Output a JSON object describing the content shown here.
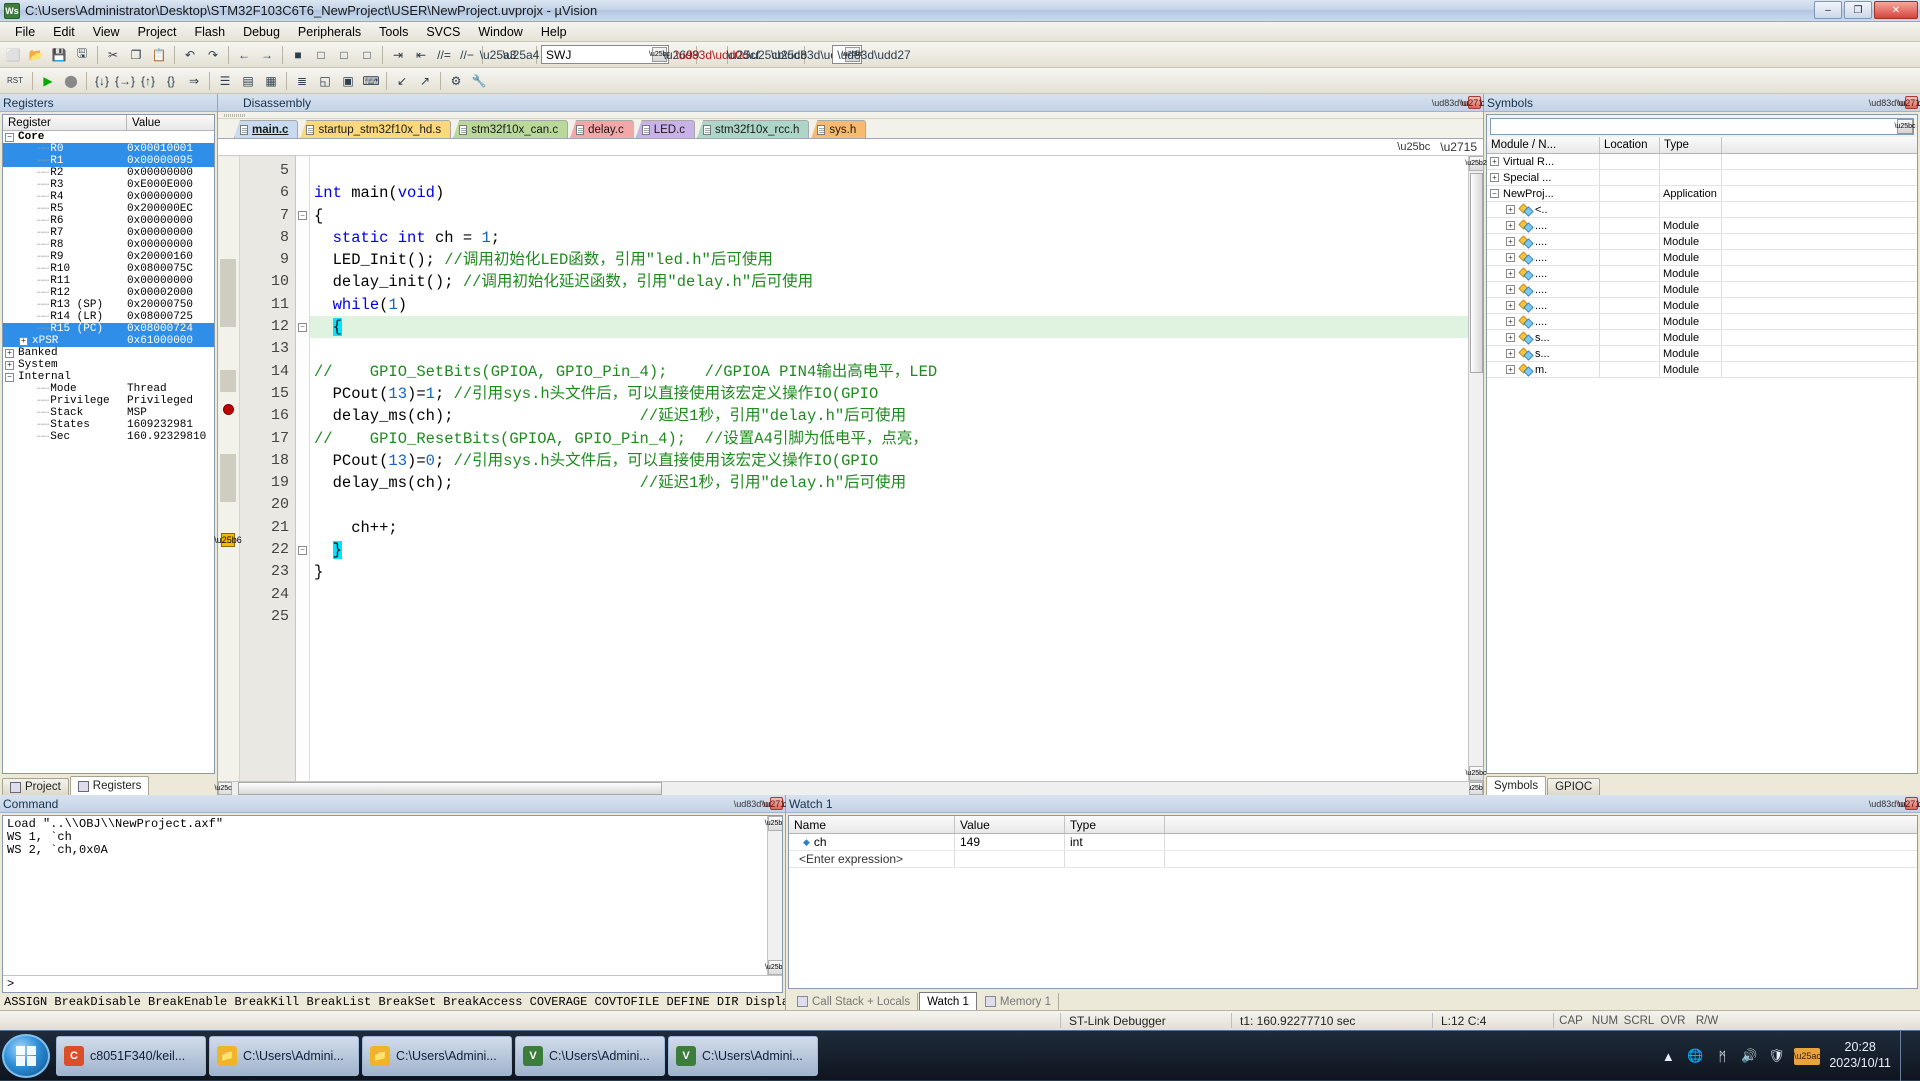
{
  "window": {
    "title": "C:\\Users\\Administrator\\Desktop\\STM32F103C6T6_NewProject\\USER\\NewProject.uvprojx - µVision",
    "app_icon": "uvision-icon",
    "minimize": "–",
    "maximize": "❐",
    "close": "✕"
  },
  "menu": {
    "items": [
      "File",
      "Edit",
      "View",
      "Project",
      "Flash",
      "Debug",
      "Peripherals",
      "Tools",
      "SVCS",
      "Window",
      "Help"
    ]
  },
  "toolbar1": {
    "buttons": [
      {
        "name": "new-file-icon",
        "glyph": "⬜"
      },
      {
        "name": "open-file-icon",
        "glyph": "📂"
      },
      {
        "name": "save-icon",
        "glyph": "💾"
      },
      {
        "name": "save-all-icon",
        "glyph": "🖫"
      },
      {
        "name": "cut-icon",
        "glyph": "✂"
      },
      {
        "name": "copy-icon",
        "glyph": "❐"
      },
      {
        "name": "paste-icon",
        "glyph": "📋"
      },
      {
        "name": "undo-icon",
        "glyph": "↶"
      },
      {
        "name": "redo-icon",
        "glyph": "↷"
      },
      {
        "name": "navigate-back-icon",
        "glyph": "←"
      },
      {
        "name": "navigate-forward-icon",
        "glyph": "→"
      },
      {
        "name": "bookmark-toggle-icon",
        "glyph": "■"
      },
      {
        "name": "bookmark-prev-icon",
        "glyph": "□"
      },
      {
        "name": "bookmark-next-icon",
        "glyph": "□"
      },
      {
        "name": "bookmark-clear-icon",
        "glyph": "□"
      },
      {
        "name": "indent-icon",
        "glyph": "⇥"
      },
      {
        "name": "outdent-icon",
        "glyph": "⇤"
      },
      {
        "name": "comment-icon",
        "glyph": "//="
      },
      {
        "name": "uncomment-icon",
        "glyph": "//−"
      }
    ],
    "debug_select_value": "SWJ",
    "search_placeholder": ""
  },
  "toolbar2": {
    "buttons": [
      {
        "name": "reset-cpu-icon",
        "glyph": "RST"
      },
      {
        "name": "run-icon",
        "glyph": "▶"
      },
      {
        "name": "stop-icon",
        "glyph": "⬤"
      },
      {
        "name": "step-icon",
        "glyph": "{↓}"
      },
      {
        "name": "step-over-icon",
        "glyph": "{→}"
      },
      {
        "name": "step-out-icon",
        "glyph": "{↑}"
      },
      {
        "name": "run-to-cursor-icon",
        "glyph": "{}"
      },
      {
        "name": "show-next-statement-icon",
        "glyph": "⇒"
      },
      {
        "name": "disassembly-window-icon",
        "glyph": "☰"
      },
      {
        "name": "symbols-window-icon",
        "glyph": "▤"
      },
      {
        "name": "registers-window-icon",
        "glyph": "▦"
      },
      {
        "name": "call-stack-icon",
        "glyph": "≣"
      },
      {
        "name": "watch-windows-icon",
        "glyph": "◱"
      },
      {
        "name": "memory-windows-icon",
        "glyph": "▣"
      },
      {
        "name": "serial-windows-icon",
        "glyph": "⌨"
      },
      {
        "name": "analysis-windows-icon",
        "glyph": "↙"
      },
      {
        "name": "trace-icon",
        "glyph": "↗"
      },
      {
        "name": "system-viewer-icon",
        "glyph": "⚙"
      },
      {
        "name": "toolbox-icon",
        "glyph": "🔧"
      }
    ]
  },
  "registers_panel": {
    "title": "Registers",
    "columns": [
      "Register",
      "Value"
    ],
    "rows": [
      {
        "name": "Core",
        "value": "",
        "indent": 0,
        "expander": "−",
        "selected": false,
        "bold": true
      },
      {
        "name": "R0",
        "value": "0x00010001",
        "indent": 2,
        "expander": "",
        "selected": true
      },
      {
        "name": "R1",
        "value": "0x00000095",
        "indent": 2,
        "expander": "",
        "selected": true
      },
      {
        "name": "R2",
        "value": "0x00000000",
        "indent": 2,
        "expander": "",
        "selected": false
      },
      {
        "name": "R3",
        "value": "0xE000E000",
        "indent": 2,
        "expander": "",
        "selected": false
      },
      {
        "name": "R4",
        "value": "0x00000000",
        "indent": 2,
        "expander": "",
        "selected": false
      },
      {
        "name": "R5",
        "value": "0x200000EC",
        "indent": 2,
        "expander": "",
        "selected": false
      },
      {
        "name": "R6",
        "value": "0x00000000",
        "indent": 2,
        "expander": "",
        "selected": false
      },
      {
        "name": "R7",
        "value": "0x00000000",
        "indent": 2,
        "expander": "",
        "selected": false
      },
      {
        "name": "R8",
        "value": "0x00000000",
        "indent": 2,
        "expander": "",
        "selected": false
      },
      {
        "name": "R9",
        "value": "0x20000160",
        "indent": 2,
        "expander": "",
        "selected": false
      },
      {
        "name": "R10",
        "value": "0x0800075C",
        "indent": 2,
        "expander": "",
        "selected": false
      },
      {
        "name": "R11",
        "value": "0x00000000",
        "indent": 2,
        "expander": "",
        "selected": false
      },
      {
        "name": "R12",
        "value": "0x00002000",
        "indent": 2,
        "expander": "",
        "selected": false
      },
      {
        "name": "R13 (SP)",
        "value": "0x20000750",
        "indent": 2,
        "expander": "",
        "selected": false
      },
      {
        "name": "R14 (LR)",
        "value": "0x08000725",
        "indent": 2,
        "expander": "",
        "selected": false
      },
      {
        "name": "R15 (PC)",
        "value": "0x08000724",
        "indent": 2,
        "expander": "",
        "selected": true
      },
      {
        "name": "xPSR",
        "value": "0x61000000",
        "indent": 1,
        "expander": "+",
        "selected": true
      },
      {
        "name": "Banked",
        "value": "",
        "indent": 0,
        "expander": "+",
        "selected": false
      },
      {
        "name": "System",
        "value": "",
        "indent": 0,
        "expander": "+",
        "selected": false
      },
      {
        "name": "Internal",
        "value": "",
        "indent": 0,
        "expander": "−",
        "selected": false
      },
      {
        "name": "Mode",
        "value": "Thread",
        "indent": 2,
        "expander": "",
        "selected": false
      },
      {
        "name": "Privilege",
        "value": "Privileged",
        "indent": 2,
        "expander": "",
        "selected": false
      },
      {
        "name": "Stack",
        "value": "MSP",
        "indent": 2,
        "expander": "",
        "selected": false
      },
      {
        "name": "States",
        "value": "1609232981",
        "indent": 2,
        "expander": "",
        "selected": false
      },
      {
        "name": "Sec",
        "value": "160.92329810",
        "indent": 2,
        "expander": "",
        "selected": false
      }
    ],
    "bottom_tabs": [
      {
        "label": "Project",
        "icon": "project-icon",
        "active": false
      },
      {
        "label": "Registers",
        "icon": "registers-icon",
        "active": true
      }
    ]
  },
  "editor": {
    "disassembly_title": "Disassembly",
    "tabs": [
      {
        "label": "main.c",
        "color": "#c9d9f0",
        "active": true
      },
      {
        "label": "startup_stm32f10x_hd.s",
        "color": "#fbd97a",
        "active": false
      },
      {
        "label": "stm32f10x_can.c",
        "color": "#b9d89a",
        "active": false
      },
      {
        "label": "delay.c",
        "color": "#f2a8a8",
        "active": false
      },
      {
        "label": "LED.c",
        "color": "#c9b2e8",
        "active": false
      },
      {
        "label": "stm32f10x_rcc.h",
        "color": "#aed6c8",
        "active": false
      },
      {
        "label": "sys.h",
        "color": "#f6bb6e",
        "active": false
      }
    ],
    "tab_menu_icon": "chevron-down-icon",
    "tab_close_icon": "close-icon",
    "lines": [
      {
        "num": 5,
        "fold": "",
        "segments": [],
        "highlight": false
      },
      {
        "num": 6,
        "fold": "",
        "segments": [
          {
            "t": "int",
            "c": "kw"
          },
          {
            "t": " main",
            "c": "plain"
          },
          {
            "t": "(",
            "c": "plain"
          },
          {
            "t": "void",
            "c": "kw"
          },
          {
            "t": ")",
            "c": "plain"
          }
        ],
        "highlight": false
      },
      {
        "num": 7,
        "fold": "−",
        "segments": [
          {
            "t": "{",
            "c": "plain"
          }
        ],
        "highlight": false
      },
      {
        "num": 8,
        "fold": "",
        "segments": [
          {
            "t": "  ",
            "c": "plain"
          },
          {
            "t": "static",
            "c": "kw"
          },
          {
            "t": " ",
            "c": "plain"
          },
          {
            "t": "int",
            "c": "kw"
          },
          {
            "t": " ch = ",
            "c": "plain"
          },
          {
            "t": "1",
            "c": "num"
          },
          {
            "t": ";",
            "c": "plain"
          }
        ],
        "highlight": false
      },
      {
        "num": 9,
        "fold": "",
        "segments": [
          {
            "t": "  LED_Init(); ",
            "c": "plain"
          },
          {
            "t": "//调用初始化LED函数，引用\"led.h\"后可使用",
            "c": "cmt"
          }
        ],
        "highlight": false
      },
      {
        "num": 10,
        "fold": "",
        "segments": [
          {
            "t": "  delay_init(); ",
            "c": "plain"
          },
          {
            "t": "//调用初始化延迟函数，引用\"delay.h\"后可使用",
            "c": "cmt"
          }
        ],
        "highlight": false
      },
      {
        "num": 11,
        "fold": "",
        "segments": [
          {
            "t": "  ",
            "c": "plain"
          },
          {
            "t": "while",
            "c": "kw"
          },
          {
            "t": "(",
            "c": "plain"
          },
          {
            "t": "1",
            "c": "num"
          },
          {
            "t": ")",
            "c": "plain"
          }
        ],
        "highlight": false
      },
      {
        "num": 12,
        "fold": "−",
        "segments": [
          {
            "t": "  ",
            "c": "plain"
          },
          {
            "t": "{",
            "c": "cursor"
          }
        ],
        "highlight": true
      },
      {
        "num": 13,
        "fold": "",
        "segments": [],
        "highlight": false
      },
      {
        "num": 14,
        "fold": "",
        "segments": [
          {
            "t": "//    GPIO_SetBits(GPIOA, GPIO_Pin_4);    //GPIOA PIN4输出高电平，LED",
            "c": "cmt"
          }
        ],
        "highlight": false
      },
      {
        "num": 15,
        "fold": "",
        "segments": [
          {
            "t": "  PCout(",
            "c": "plain"
          },
          {
            "t": "13",
            "c": "num"
          },
          {
            "t": ")=",
            "c": "plain"
          },
          {
            "t": "1",
            "c": "num"
          },
          {
            "t": "; ",
            "c": "plain"
          },
          {
            "t": "//引用sys.h头文件后，可以直接使用该宏定义操作IO(GPIO",
            "c": "cmt"
          }
        ],
        "highlight": false
      },
      {
        "num": 16,
        "fold": "",
        "segments": [
          {
            "t": "  delay_ms(ch);                    ",
            "c": "plain"
          },
          {
            "t": "//延迟1秒，引用\"delay.h\"后可使用",
            "c": "cmt"
          }
        ],
        "highlight": false
      },
      {
        "num": 17,
        "fold": "",
        "segments": [
          {
            "t": "//    GPIO_ResetBits(GPIOA, GPIO_Pin_4);  //设置A4引脚为低电平，点亮，",
            "c": "cmt"
          }
        ],
        "highlight": false
      },
      {
        "num": 18,
        "fold": "",
        "segments": [
          {
            "t": "  PCout(",
            "c": "plain"
          },
          {
            "t": "13",
            "c": "num"
          },
          {
            "t": ")=",
            "c": "plain"
          },
          {
            "t": "0",
            "c": "num"
          },
          {
            "t": "; ",
            "c": "plain"
          },
          {
            "t": "//引用sys.h头文件后，可以直接使用该宏定义操作IO(GPIO",
            "c": "cmt"
          }
        ],
        "highlight": false
      },
      {
        "num": 19,
        "fold": "",
        "segments": [
          {
            "t": "  delay_ms(ch);                    ",
            "c": "plain"
          },
          {
            "t": "//延迟1秒，引用\"delay.h\"后可使用",
            "c": "cmt"
          }
        ],
        "highlight": false
      },
      {
        "num": 20,
        "fold": "",
        "segments": [],
        "highlight": false
      },
      {
        "num": 21,
        "fold": "",
        "segments": [
          {
            "t": "    ch++;",
            "c": "plain"
          }
        ],
        "highlight": false
      },
      {
        "num": 22,
        "fold": "−",
        "segments": [
          {
            "t": "  ",
            "c": "plain"
          },
          {
            "t": "}",
            "c": "cursor"
          }
        ],
        "highlight": false
      },
      {
        "num": 23,
        "fold": "",
        "segments": [
          {
            "t": "}",
            "c": "plain"
          }
        ],
        "highlight": false
      },
      {
        "num": 24,
        "fold": "",
        "segments": [],
        "highlight": false
      },
      {
        "num": 25,
        "fold": "",
        "segments": [],
        "highlight": false
      }
    ],
    "breakpoint_marker": "breakpoint-icon",
    "execution_marker": "execution-arrow-icon"
  },
  "symbols_panel": {
    "title": "Symbols",
    "filter_value": "",
    "columns": [
      "Module / N...",
      "Location",
      "Type"
    ],
    "rows": [
      {
        "name": "Virtual R...",
        "location": "",
        "type": "",
        "indent": 0,
        "expander": "+",
        "icon": false
      },
      {
        "name": "Special ...",
        "location": "",
        "type": "",
        "indent": 0,
        "expander": "+",
        "icon": false
      },
      {
        "name": "NewProj...",
        "location": "",
        "type": "Application",
        "indent": 0,
        "expander": "−",
        "icon": false
      },
      {
        "name": "<..",
        "location": "",
        "type": "",
        "indent": 1,
        "expander": "+",
        "icon": true
      },
      {
        "name": "....",
        "location": "",
        "type": "Module",
        "indent": 1,
        "expander": "+",
        "icon": true
      },
      {
        "name": "....",
        "location": "",
        "type": "Module",
        "indent": 1,
        "expander": "+",
        "icon": true
      },
      {
        "name": "....",
        "location": "",
        "type": "Module",
        "indent": 1,
        "expander": "+",
        "icon": true
      },
      {
        "name": "....",
        "location": "",
        "type": "Module",
        "indent": 1,
        "expander": "+",
        "icon": true
      },
      {
        "name": "....",
        "location": "",
        "type": "Module",
        "indent": 1,
        "expander": "+",
        "icon": true
      },
      {
        "name": "....",
        "location": "",
        "type": "Module",
        "indent": 1,
        "expander": "+",
        "icon": true
      },
      {
        "name": "....",
        "location": "",
        "type": "Module",
        "indent": 1,
        "expander": "+",
        "icon": true
      },
      {
        "name": "s...",
        "location": "",
        "type": "Module",
        "indent": 1,
        "expander": "+",
        "icon": true
      },
      {
        "name": "s...",
        "location": "",
        "type": "Module",
        "indent": 1,
        "expander": "+",
        "icon": true
      },
      {
        "name": "m.",
        "location": "",
        "type": "Module",
        "indent": 1,
        "expander": "+",
        "icon": true
      }
    ],
    "bottom_tabs": [
      {
        "label": "Symbols",
        "active": true
      },
      {
        "label": "GPIOC",
        "active": false
      }
    ]
  },
  "command_panel": {
    "title": "Command",
    "output_lines": [
      "Load \"..\\\\OBJ\\\\NewProject.axf\"",
      "WS 1, `ch",
      "WS 2, `ch,0x0A"
    ],
    "prompt": ">",
    "help_line": "ASSIGN BreakDisable BreakEnable BreakKill BreakList BreakSet BreakAccess COVERAGE COVTOFILE DEFINE DIR Display Enter"
  },
  "watch_panel": {
    "title": "Watch 1",
    "columns": [
      "Name",
      "Value",
      "Type"
    ],
    "rows": [
      {
        "name": "ch",
        "value": "149",
        "type": "int",
        "has_icon": true
      },
      {
        "name": "<Enter expression>",
        "value": "",
        "type": "",
        "has_icon": false
      }
    ],
    "bottom_tabs": [
      {
        "label": "Call Stack + Locals",
        "icon": "call-stack-icon",
        "active": false
      },
      {
        "label": "Watch 1",
        "icon": "",
        "active": true
      },
      {
        "label": "Memory 1",
        "icon": "memory-icon",
        "active": false
      }
    ]
  },
  "statusbar": {
    "debugger": "ST-Link Debugger",
    "time": "t1: 160.92277710 sec",
    "position": "L:12 C:4",
    "flags": [
      "CAP",
      "NUM",
      "SCRL",
      "OVR",
      "R/W"
    ]
  },
  "taskbar": {
    "start_icon": "windows-start-icon",
    "items": [
      {
        "label": "c8051F340/keil...",
        "icon_color": "#d94f2a",
        "icon_text": "C"
      },
      {
        "label": "C:\\Users\\Admini...",
        "icon_color": "#f0b429",
        "icon_text": "📁"
      },
      {
        "label": "C:\\Users\\Admini...",
        "icon_color": "#f0b429",
        "icon_text": "📁"
      },
      {
        "label": "C:\\Users\\Admini...",
        "icon_color": "#3c7d3c",
        "icon_text": "V"
      },
      {
        "label": "C:\\Users\\Admini...",
        "icon_color": "#3c7d3c",
        "icon_text": "V"
      }
    ],
    "tray": [
      {
        "name": "show-hidden-icon",
        "glyph": "▲"
      },
      {
        "name": "network-icon",
        "glyph": "🌐"
      },
      {
        "name": "bluetooth-icon",
        "glyph": "ᛗ"
      },
      {
        "name": "volume-icon",
        "glyph": "🔊"
      },
      {
        "name": "security-icon",
        "glyph": "🛡"
      }
    ],
    "clock_time": "20:28",
    "clock_date": "2023/10/11"
  }
}
